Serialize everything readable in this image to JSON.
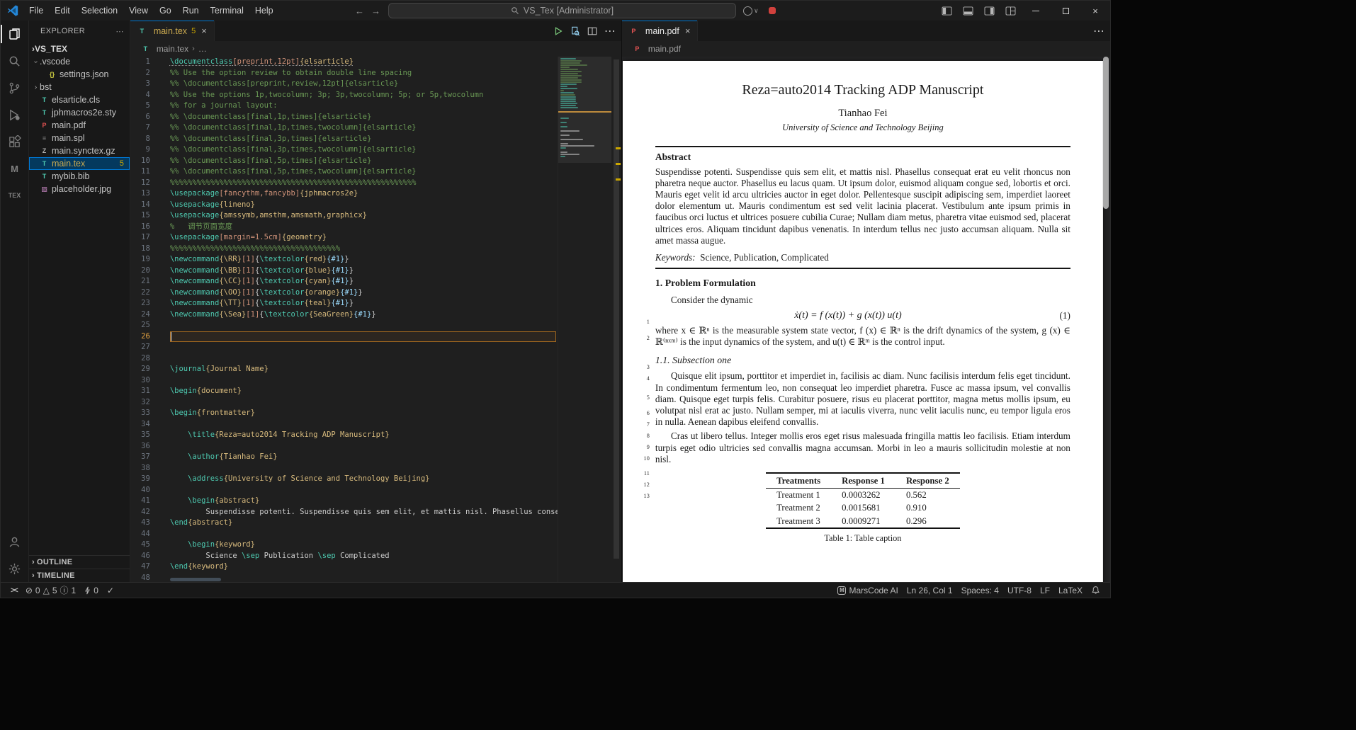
{
  "title_bar": {
    "menus": {
      "file": "File",
      "edit": "Edit",
      "selection": "Selection",
      "view": "View",
      "go": "Go",
      "run": "Run",
      "terminal": "Terminal",
      "help": "Help"
    },
    "search_text": "VS_Tex [Administrator]"
  },
  "activity_bar": {
    "icons": [
      "files",
      "search",
      "source-control",
      "run-debug",
      "extensions",
      "marscode",
      "latex-workshop",
      "account",
      "settings-gear"
    ],
    "latex_label": "TEX",
    "marscode_label": "M"
  },
  "explorer": {
    "title": "EXPLORER",
    "root": "VS_TEX",
    "items": [
      {
        "label": ".vscode",
        "level": 1,
        "twisty": "open"
      },
      {
        "label": "settings.json",
        "level": 2,
        "icon": "json"
      },
      {
        "label": "bst",
        "level": 1,
        "twisty": "closed"
      },
      {
        "label": "elsarticle.cls",
        "level": 1,
        "icon": "tex"
      },
      {
        "label": "jphmacros2e.sty",
        "level": 1,
        "icon": "tex"
      },
      {
        "label": "main.pdf",
        "level": 1,
        "icon": "pdf"
      },
      {
        "label": "main.spl",
        "level": 1,
        "icon": "file"
      },
      {
        "label": "main.synctex.gz",
        "level": 1,
        "icon": "zip"
      },
      {
        "label": "main.tex",
        "level": 1,
        "icon": "tex",
        "selected": true,
        "badge": "5",
        "warn": true
      },
      {
        "label": "mybib.bib",
        "level": 1,
        "icon": "tex"
      },
      {
        "label": "placeholder.jpg",
        "level": 1,
        "icon": "image"
      }
    ],
    "sections": [
      "OUTLINE",
      "TIMELINE"
    ]
  },
  "editor": {
    "tab_label": "main.tex",
    "tab_badge": "5",
    "breadcrumb": "main.tex",
    "breadcrumb_more": "…",
    "current_line": 26,
    "code_lines": [
      {
        "s": [
          [
            "c",
            "\\documentclass"
          ],
          [
            "o",
            "[preprint,12pt]"
          ],
          [
            "a",
            "{elsarticle}"
          ]
        ],
        "u": true
      },
      {
        "s": [
          [
            "m",
            "%% Use the option review to obtain double line spacing"
          ]
        ]
      },
      {
        "s": [
          [
            "m",
            "%% \\documentclass[preprint,review,12pt]{elsarticle}"
          ]
        ]
      },
      {
        "s": [
          [
            "m",
            "%% Use the options 1p,twocolumn; 3p; 3p,twocolumn; 5p; or 5p,twocolumn"
          ]
        ]
      },
      {
        "s": [
          [
            "m",
            "%% for a journal layout:"
          ]
        ]
      },
      {
        "s": [
          [
            "m",
            "%% \\documentclass[final,1p,times]{elsarticle}"
          ]
        ]
      },
      {
        "s": [
          [
            "m",
            "%% \\documentclass[final,1p,times,twocolumn]{elsarticle}"
          ]
        ]
      },
      {
        "s": [
          [
            "m",
            "%% \\documentclass[final,3p,times]{elsarticle}"
          ]
        ]
      },
      {
        "s": [
          [
            "m",
            "%% \\documentclass[final,3p,times,twocolumn]{elsarticle}"
          ]
        ]
      },
      {
        "s": [
          [
            "m",
            "%% \\documentclass[final,5p,times]{elsarticle}"
          ]
        ]
      },
      {
        "s": [
          [
            "m",
            "%% \\documentclass[final,5p,times,twocolumn]{elsarticle}"
          ]
        ]
      },
      {
        "s": [
          [
            "m",
            "%%%%%%%%%%%%%%%%%%%%%%%%%%%%%%%%%%%%%%%%%%%%%%%%%%%%%%%"
          ]
        ]
      },
      {
        "s": [
          [
            "c",
            "\\usepackage"
          ],
          [
            "o",
            "[fancythm,fancybb]"
          ],
          [
            "a",
            "{jphmacros2e}"
          ]
        ]
      },
      {
        "s": [
          [
            "c",
            "\\usepackage"
          ],
          [
            "a",
            "{lineno}"
          ]
        ]
      },
      {
        "s": [
          [
            "c",
            "\\usepackage"
          ],
          [
            "a",
            "{amssymb,amsthm,amsmath,graphicx}"
          ]
        ]
      },
      {
        "s": [
          [
            "m",
            "%   调节页面宽度"
          ]
        ]
      },
      {
        "s": [
          [
            "c",
            "\\usepackage"
          ],
          [
            "o",
            "[margin=1.5cm]"
          ],
          [
            "a",
            "{geometry}"
          ]
        ]
      },
      {
        "s": [
          [
            "m",
            "%%%%%%%%%%%%%%%%%%%%%%%%%%%%%%%%%%%%%%"
          ]
        ]
      },
      {
        "s": [
          [
            "c",
            "\\newcommand"
          ],
          [
            "a",
            "{\\RR}"
          ],
          [
            "o",
            "[1]"
          ],
          [
            "t",
            "{"
          ],
          [
            "c",
            "\\textcolor"
          ],
          [
            "a",
            "{red}"
          ],
          [
            "p",
            "{#1}"
          ],
          [
            "t",
            "}"
          ]
        ]
      },
      {
        "s": [
          [
            "c",
            "\\newcommand"
          ],
          [
            "a",
            "{\\BB}"
          ],
          [
            "o",
            "[1]"
          ],
          [
            "t",
            "{"
          ],
          [
            "c",
            "\\textcolor"
          ],
          [
            "a",
            "{blue}"
          ],
          [
            "p",
            "{#1}"
          ],
          [
            "t",
            "}"
          ]
        ]
      },
      {
        "s": [
          [
            "c",
            "\\newcommand"
          ],
          [
            "a",
            "{\\CC}"
          ],
          [
            "o",
            "[1]"
          ],
          [
            "t",
            "{"
          ],
          [
            "c",
            "\\textcolor"
          ],
          [
            "a",
            "{cyan}"
          ],
          [
            "p",
            "{#1}"
          ],
          [
            "t",
            "}"
          ]
        ]
      },
      {
        "s": [
          [
            "c",
            "\\newcommand"
          ],
          [
            "a",
            "{\\OO}"
          ],
          [
            "o",
            "[1]"
          ],
          [
            "t",
            "{"
          ],
          [
            "c",
            "\\textcolor"
          ],
          [
            "a",
            "{orange}"
          ],
          [
            "p",
            "{#1}"
          ],
          [
            "t",
            "}"
          ]
        ]
      },
      {
        "s": [
          [
            "c",
            "\\newcommand"
          ],
          [
            "a",
            "{\\TT}"
          ],
          [
            "o",
            "[1]"
          ],
          [
            "t",
            "{"
          ],
          [
            "c",
            "\\textcolor"
          ],
          [
            "a",
            "{teal}"
          ],
          [
            "p",
            "{#1}"
          ],
          [
            "t",
            "}"
          ]
        ]
      },
      {
        "s": [
          [
            "c",
            "\\newcommand"
          ],
          [
            "a",
            "{\\Sea}"
          ],
          [
            "o",
            "[1]"
          ],
          [
            "t",
            "{"
          ],
          [
            "c",
            "\\textcolor"
          ],
          [
            "a",
            "{SeaGreen}"
          ],
          [
            "p",
            "{#1}"
          ],
          [
            "t",
            "}"
          ]
        ]
      },
      {
        "s": []
      },
      {
        "s": []
      },
      {
        "s": []
      },
      {
        "s": []
      },
      {
        "s": [
          [
            "c",
            "\\journal"
          ],
          [
            "a",
            "{Journal Name}"
          ]
        ]
      },
      {
        "s": []
      },
      {
        "s": [
          [
            "c",
            "\\begin"
          ],
          [
            "a",
            "{document}"
          ]
        ]
      },
      {
        "s": []
      },
      {
        "s": [
          [
            "c",
            "\\begin"
          ],
          [
            "a",
            "{frontmatter}"
          ]
        ]
      },
      {
        "s": []
      },
      {
        "s": [
          [
            "t",
            "    "
          ],
          [
            "c",
            "\\title"
          ],
          [
            "a",
            "{Reza=auto2014 Tracking ADP Manuscript}"
          ]
        ]
      },
      {
        "s": []
      },
      {
        "s": [
          [
            "t",
            "    "
          ],
          [
            "c",
            "\\author"
          ],
          [
            "a",
            "{Tianhao Fei}"
          ]
        ]
      },
      {
        "s": []
      },
      {
        "s": [
          [
            "t",
            "    "
          ],
          [
            "c",
            "\\address"
          ],
          [
            "a",
            "{University of Science and Technology Beijing}"
          ]
        ]
      },
      {
        "s": []
      },
      {
        "s": [
          [
            "t",
            "    "
          ],
          [
            "c",
            "\\begin"
          ],
          [
            "a",
            "{abstract}"
          ]
        ]
      },
      {
        "s": [
          [
            "t",
            "        Suspendisse potenti. Suspendisse quis sem elit, et mattis nisl. Phasellus conse"
          ]
        ]
      },
      {
        "s": [
          [
            "c",
            "\\end"
          ],
          [
            "a",
            "{abstract}"
          ]
        ]
      },
      {
        "s": []
      },
      {
        "s": [
          [
            "t",
            "    "
          ],
          [
            "c",
            "\\begin"
          ],
          [
            "a",
            "{keyword}"
          ]
        ]
      },
      {
        "s": [
          [
            "t",
            "        Science "
          ],
          [
            "c",
            "\\sep"
          ],
          [
            "t",
            " Publication "
          ],
          [
            "c",
            "\\sep"
          ],
          [
            "t",
            " Complicated"
          ]
        ]
      },
      {
        "s": [
          [
            "c",
            "\\end"
          ],
          [
            "a",
            "{keyword}"
          ]
        ]
      },
      {
        "s": []
      }
    ],
    "syntax_colors": {
      "c": "#4ec9b0",
      "o": "#ce9178",
      "a": "#d7ba7d",
      "m": "#6a9955",
      "t": "#cccccc",
      "p": "#9cdcfe"
    }
  },
  "pdf": {
    "tab_label": "main.pdf",
    "breadcrumb": "main.pdf",
    "doc": {
      "title": "Reza=auto2014 Tracking ADP Manuscript",
      "author": "Tianhao Fei",
      "affiliation": "University of Science and Technology Beijing",
      "abstract_heading": "Abstract",
      "abstract": "Suspendisse potenti. Suspendisse quis sem elit, et mattis nisl. Phasellus consequat erat eu velit rhoncus non pharetra neque auctor. Phasellus eu lacus quam. Ut ipsum dolor, euismod aliquam congue sed, lobortis et orci. Mauris eget velit id arcu ultricies auctor in eget dolor. Pellentesque suscipit adipiscing sem, imperdiet laoreet dolor elementum ut. Mauris condimentum est sed velit lacinia placerat. Vestibulum ante ipsum primis in faucibus orci luctus et ultrices posuere cubilia Curae; Nullam diam metus, pharetra vitae euismod sed, placerat ultrices eros. Aliquam tincidunt dapibus venenatis. In interdum tellus nec justo accumsan aliquam. Nulla sit amet massa augue.",
      "keywords_label": "Keywords:",
      "keywords": "Science, Publication, Complicated",
      "section1": "1. Problem Formulation",
      "para_intro": "Consider the dynamic",
      "equation": "ẋ(t) = f (x(t)) + g (x(t)) u(t)",
      "equation_number": "(1)",
      "para_where": "where x ∈ ℝⁿ is the measurable system state vector, f (x) ∈ ℝⁿ is the drift dynamics of the system, g (x) ∈ ℝ⁽ⁿˣᵐ⁾ is the input dynamics of the system, and u(t) ∈ ℝᵐ is the control input.",
      "subsection": "1.1. Subsection one",
      "para_quisque": "Quisque elit ipsum, porttitor et imperdiet in, facilisis ac diam. Nunc facilisis interdum felis eget tincidunt. In condimentum fermentum leo, non consequat leo imperdiet pharetra. Fusce ac massa ipsum, vel convallis diam. Quisque eget turpis felis. Curabitur posuere, risus eu placerat porttitor, magna metus mollis ipsum, eu volutpat nisl erat ac justo. Nullam semper, mi at iaculis viverra, nunc velit iaculis nunc, eu tempor ligula eros in nulla. Aenean dapibus eleifend convallis.",
      "para_cras": "Cras ut libero tellus. Integer mollis eros eget risus malesuada fringilla mattis leo facilisis. Etiam interdum turpis eget odio ultricies sed convallis magna accumsan. Morbi in leo a mauris sollicitudin molestie at non nisl.",
      "margin_line_numbers": [
        "1",
        "2",
        "3",
        "4",
        "5",
        "6",
        "7",
        "8",
        "9",
        "10",
        "11",
        "12",
        "13"
      ],
      "table": {
        "headers": [
          "Treatments",
          "Response 1",
          "Response 2"
        ],
        "rows": [
          [
            "Treatment 1",
            "0.0003262",
            "0.562"
          ],
          [
            "Treatment 2",
            "0.0015681",
            "0.910"
          ],
          [
            "Treatment 3",
            "0.0009271",
            "0.296"
          ]
        ]
      },
      "table_caption": "Table 1: Table caption"
    }
  },
  "status_bar": {
    "remote": "><",
    "errors": "0",
    "warnings": "5",
    "infos": "1",
    "bolt_count": "0",
    "check": "✓",
    "marscode": "MarsCode AI",
    "cursor_position": "Ln 26, Col 1",
    "indentation": "Spaces: 4",
    "encoding": "UTF-8",
    "eol": "LF",
    "language": "LaTeX"
  }
}
